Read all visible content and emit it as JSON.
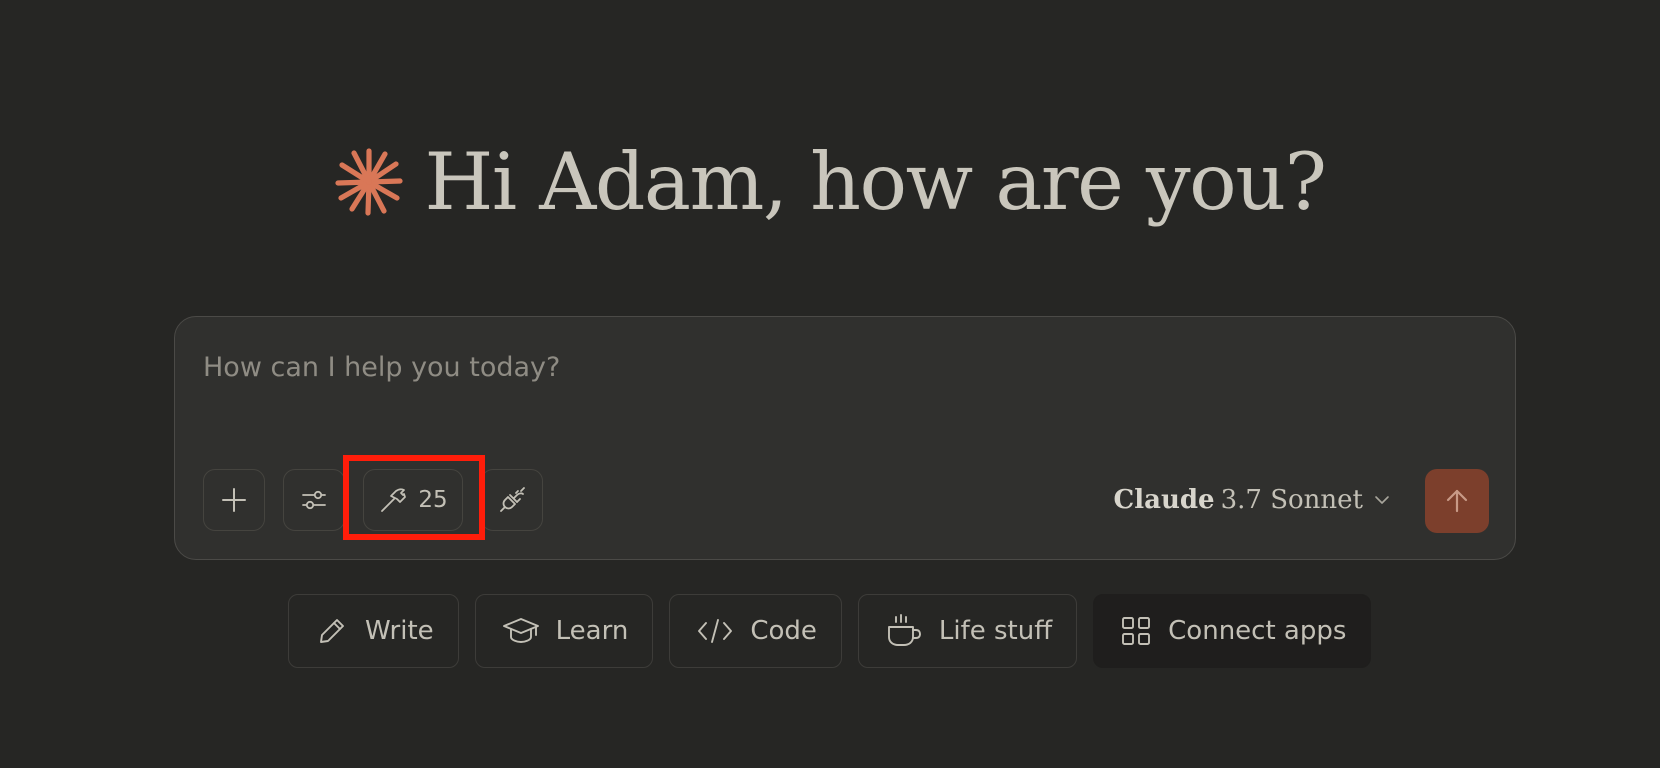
{
  "greeting": {
    "text": "Hi Adam, how are you?"
  },
  "composer": {
    "placeholder": "How can I help you today?",
    "value": "",
    "tools_count": "25",
    "model": {
      "brand": "Claude",
      "version": "3.7 Sonnet"
    }
  },
  "quick_actions": [
    {
      "label": "Write",
      "icon": "pencil-icon"
    },
    {
      "label": "Learn",
      "icon": "graduation-cap-icon"
    },
    {
      "label": "Code",
      "icon": "code-icon"
    },
    {
      "label": "Life stuff",
      "icon": "coffee-cup-icon"
    },
    {
      "label": "Connect apps",
      "icon": "grid-icon"
    }
  ],
  "colors": {
    "background": "#262624",
    "composer": "#30302e",
    "accent": "#d97757",
    "send_button": "#7c3f2c",
    "highlight": "#ff1d0a"
  }
}
